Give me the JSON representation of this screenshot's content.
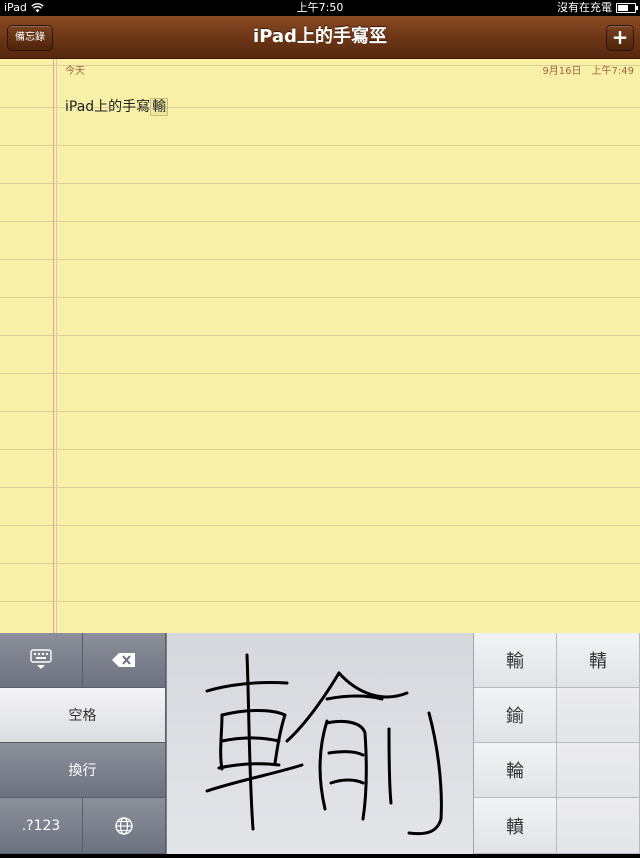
{
  "status_bar": {
    "device": "iPad",
    "time": "上午7:50",
    "charging": "沒有在充電"
  },
  "toolbar": {
    "back_label": "備忘錄",
    "title": "iPad上的手寫巠",
    "add_label": "+"
  },
  "note": {
    "day_label": "今天",
    "date": "9月16日",
    "time": "上午7:49",
    "text": "iPad上的手寫",
    "marked_text": "輸"
  },
  "keyboard": {
    "space_label": "空格",
    "return_label": "換行",
    "numbers_label": ".?123",
    "candidates": [
      "輸",
      "輤",
      "鍮",
      "",
      "輪",
      "",
      "轒",
      ""
    ]
  }
}
